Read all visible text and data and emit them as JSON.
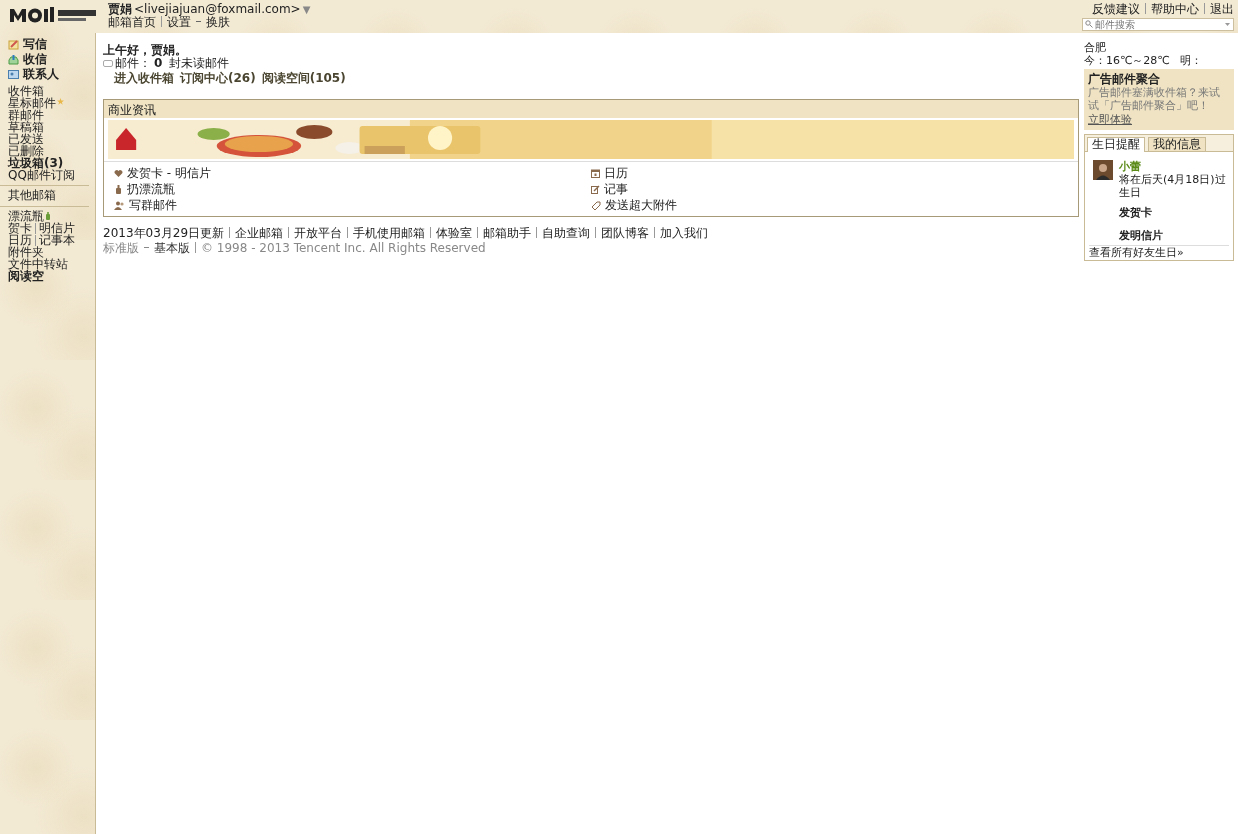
{
  "header": {
    "user_name": "贾娟",
    "email": "<livejiajuan@foxmail.com>",
    "caret": "▼",
    "nav": [
      {
        "label": "邮箱首页"
      },
      {
        "label": "设置"
      },
      {
        "label": "换肤"
      }
    ],
    "top_links": [
      {
        "label": "反馈建议"
      },
      {
        "label": "帮助中心"
      },
      {
        "label": "退出"
      }
    ],
    "search": {
      "placeholder": "邮件搜索"
    }
  },
  "sidebar": {
    "actions": [
      {
        "label": "写信"
      },
      {
        "label": "收信"
      },
      {
        "label": "联系人"
      }
    ],
    "folders": [
      {
        "label": "收件箱",
        "bold": false,
        "star": false
      },
      {
        "label": "星标邮件",
        "bold": false,
        "star": true
      },
      {
        "label": "群邮件",
        "bold": false,
        "star": false
      },
      {
        "label": "草稿箱",
        "bold": false,
        "star": false
      },
      {
        "label": "已发送",
        "bold": false,
        "star": false
      },
      {
        "label": "已删除",
        "bold": false,
        "star": false
      },
      {
        "label": "垃圾箱(3)",
        "bold": true,
        "star": false
      },
      {
        "label": "QQ邮件订阅",
        "bold": false,
        "star": false
      }
    ],
    "other": "其他邮箱",
    "apps": [
      [
        {
          "label": "漂流瓶",
          "bottle": true
        }
      ],
      [
        {
          "label": "贺卡",
          "bottle": false
        },
        {
          "label": "明信片",
          "bottle": false
        }
      ],
      [
        {
          "label": "日历",
          "bottle": false
        },
        {
          "label": "记事本",
          "bottle": false
        }
      ],
      [
        {
          "label": "附件夹",
          "bottle": false
        }
      ],
      [
        {
          "label": "文件中转站",
          "bottle": false
        }
      ],
      [
        {
          "label": "阅读空",
          "bottle": false,
          "bold": true
        }
      ]
    ]
  },
  "greeting": "上午好，贾娟。",
  "mail_status": {
    "prefix": "邮件：",
    "count": "0",
    "suffix": "封未读邮件"
  },
  "quick_links": [
    {
      "label": "进入收件箱"
    },
    {
      "label": "订阅中心(26)"
    },
    {
      "label": "阅读空间(105)"
    }
  ],
  "business": {
    "title": "商业资讯",
    "links": [
      {
        "label": "发贺卡 - 明信片"
      },
      {
        "label": "日历"
      },
      {
        "label": "扔漂流瓶"
      },
      {
        "label": "记事"
      },
      {
        "label": "写群邮件"
      },
      {
        "label": "发送超大附件"
      }
    ]
  },
  "footer": {
    "links": [
      {
        "label": "2013年03月29日更新"
      },
      {
        "label": "企业邮箱"
      },
      {
        "label": "开放平台"
      },
      {
        "label": "手机使用邮箱"
      },
      {
        "label": "体验室"
      },
      {
        "label": "邮箱助手"
      },
      {
        "label": "自助查询"
      },
      {
        "label": "团队博客"
      },
      {
        "label": "加入我们"
      }
    ],
    "version": "标准版",
    "basic": "基本版",
    "copyright": "© 1998 - 2013 Tencent Inc. All Rights Reserved"
  },
  "weather": {
    "city": "合肥",
    "today": "今：16℃～28℃",
    "tomorrow": "明："
  },
  "ad": {
    "title": "广告邮件聚合",
    "text": "广告邮件塞满收件箱？来试试「广告邮件聚合」吧！",
    "link": "立即体验"
  },
  "birthday": {
    "tabs": [
      {
        "label": "生日提醒",
        "selected": true
      },
      {
        "label": "我的信息",
        "selected": false
      }
    ],
    "friend": "小蕾",
    "when": "将在后天(4月18日)过生日",
    "actions": [
      {
        "label": "发贺卡"
      },
      {
        "label": "发明信片"
      }
    ],
    "all": "查看所有好友生日»"
  }
}
